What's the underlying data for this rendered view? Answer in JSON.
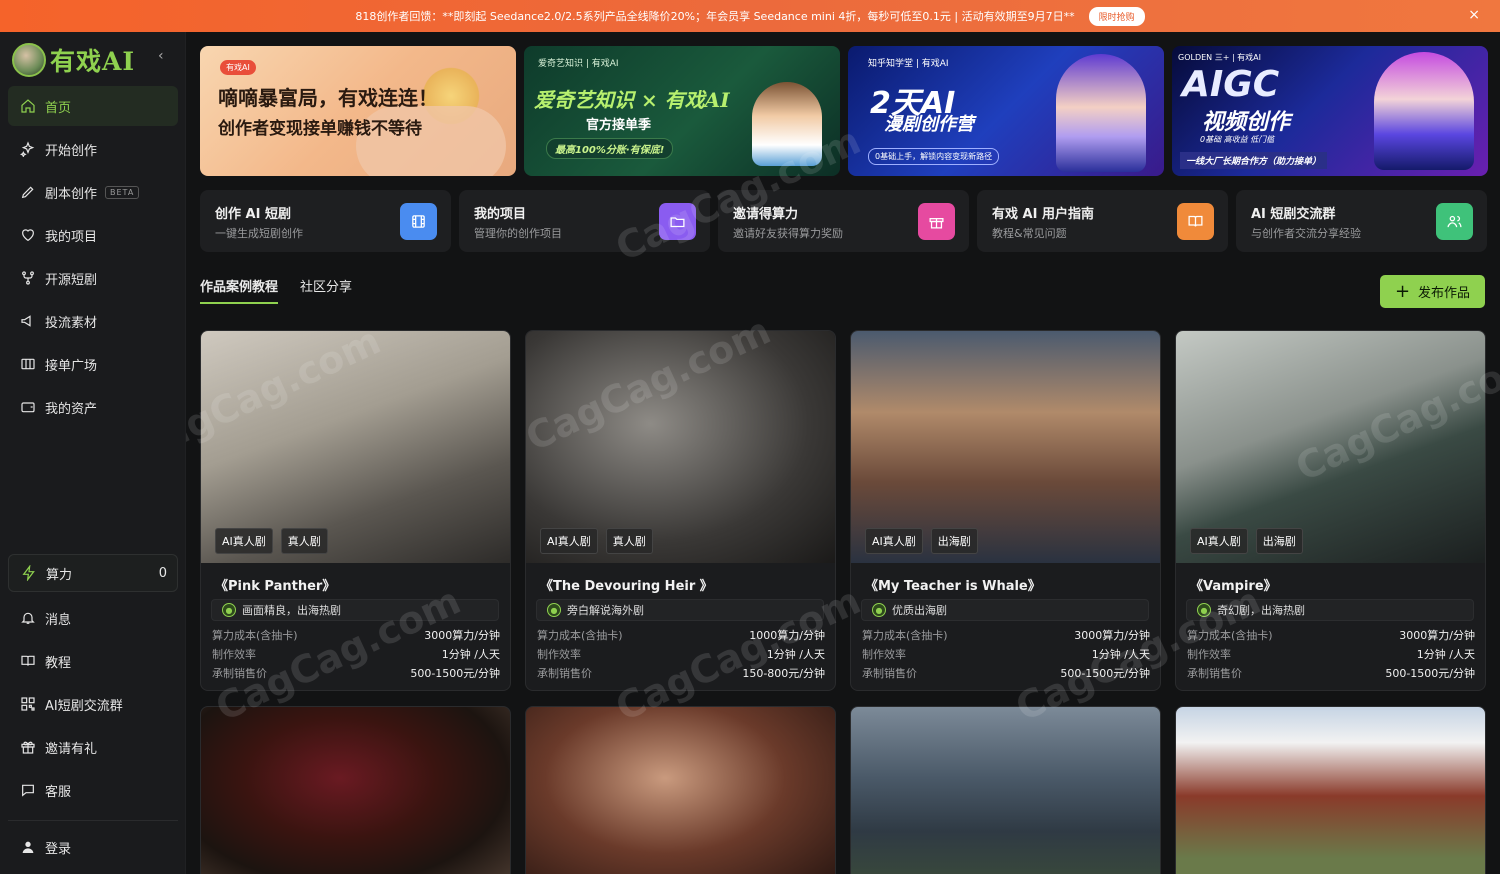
{
  "promo": {
    "text": "818创作者回馈：**即刻起 Seedance2.0/2.5系列产品全线降价20%；年会员享 Seedance mini 4折，每秒可低至0.1元 | 活动有效期至9月7日**",
    "button": "限时抢购",
    "close": "×"
  },
  "brand": {
    "name": "有戏AI",
    "collapse": "‹"
  },
  "nav": [
    {
      "label": "首页",
      "icon": "home-icon"
    },
    {
      "label": "开始创作",
      "icon": "sparkle-icon"
    },
    {
      "label": "剧本创作",
      "icon": "pen-icon",
      "badge": "BETA"
    },
    {
      "label": "我的项目",
      "icon": "heart-icon"
    },
    {
      "label": "开源短剧",
      "icon": "fork-icon"
    },
    {
      "label": "投流素材",
      "icon": "megaphone-icon"
    },
    {
      "label": "接单广场",
      "icon": "columns-icon"
    },
    {
      "label": "我的资产",
      "icon": "wallet-icon"
    }
  ],
  "power": {
    "label": "算力",
    "value": "0"
  },
  "nav2": [
    {
      "label": "消息",
      "icon": "bell-icon"
    },
    {
      "label": "教程",
      "icon": "book-icon"
    },
    {
      "label": "AI短剧交流群",
      "icon": "qr-icon"
    },
    {
      "label": "邀请有礼",
      "icon": "gift-icon"
    },
    {
      "label": "客服",
      "icon": "chat-icon"
    }
  ],
  "login": {
    "label": "登录"
  },
  "banners": {
    "b1": {
      "tag": "有戏AI",
      "line1": "嘀嘀暴富局，有戏连连！",
      "line2": "创作者变现接单赚钱不等待"
    },
    "b2": {
      "logos": "爱奇艺知识 | 有戏AI",
      "title": "爱奇艺知识 × 有戏AI",
      "subtitle": "官方接单季",
      "badge": "最高100%分账·有保底!"
    },
    "b3": {
      "logos": "知乎知学堂 | 有戏AI",
      "title": "2天AI",
      "subtitle": "漫剧创作营",
      "note": "0基础上手，解锁内容变现新路径"
    },
    "b4": {
      "logos": "GOLDEN 三+ | 有戏AI",
      "title": "AIGC",
      "subtitle": "视频创作",
      "tags": "0基础  高收益  低门槛",
      "footer": "一线大厂长期合作方（助力接单）"
    }
  },
  "quick": [
    {
      "title": "创作 AI 短剧",
      "sub": "一键生成短剧创作",
      "color": "#4a8cf0",
      "icon": "film-icon"
    },
    {
      "title": "我的项目",
      "sub": "管理你的创作项目",
      "color": "#8a5cf0",
      "icon": "folder-icon"
    },
    {
      "title": "邀请得算力",
      "sub": "邀请好友获得算力奖励",
      "color": "#e64aa0",
      "icon": "gift-icon"
    },
    {
      "title": "有戏 AI 用户指南",
      "sub": "教程&常见问题",
      "color": "#f08a3a",
      "icon": "book-icon"
    },
    {
      "title": "AI 短剧交流群",
      "sub": "与创作者交流分享经验",
      "color": "#3fc27a",
      "icon": "users-icon"
    }
  ],
  "tabs": [
    "作品案例教程",
    "社区分享"
  ],
  "publish": {
    "label": "发布作品",
    "icon": "+"
  },
  "cards": [
    {
      "tags": [
        "AI真人剧",
        "真人剧"
      ],
      "title": "《Pink Panther》",
      "feature": "画面精良，出海热剧",
      "rows": [
        [
          "算力成本(含抽卡)",
          "3000算力/分钟"
        ],
        [
          "制作效率",
          "1分钟 /人天"
        ],
        [
          "承制销售价",
          "500-1500元/分钟"
        ]
      ]
    },
    {
      "tags": [
        "AI真人剧",
        "真人剧"
      ],
      "title": "《The Devouring Heir 》",
      "feature": "旁白解说海外剧",
      "rows": [
        [
          "算力成本(含抽卡)",
          "1000算力/分钟"
        ],
        [
          "制作效率",
          "1分钟 /人天"
        ],
        [
          "承制销售价",
          "150-800元/分钟"
        ]
      ]
    },
    {
      "tags": [
        "AI真人剧",
        "出海剧"
      ],
      "title": "《My Teacher is Whale》",
      "feature": "优质出海剧",
      "rows": [
        [
          "算力成本(含抽卡)",
          "3000算力/分钟"
        ],
        [
          "制作效率",
          "1分钟 /人天"
        ],
        [
          "承制销售价",
          "500-1500元/分钟"
        ]
      ]
    },
    {
      "tags": [
        "AI真人剧",
        "出海剧"
      ],
      "title": "《Vampire》",
      "feature": "奇幻剧，出海热剧",
      "rows": [
        [
          "算力成本(含抽卡)",
          "3000算力/分钟"
        ],
        [
          "制作效率",
          "1分钟 /人天"
        ],
        [
          "承制销售价",
          "500-1500元/分钟"
        ]
      ]
    }
  ],
  "watermark": "CagCag.com"
}
